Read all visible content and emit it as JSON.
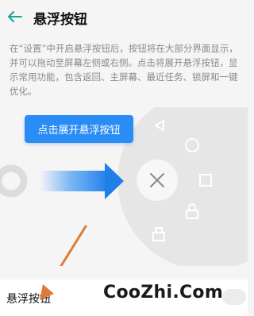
{
  "header": {
    "title": "悬浮按钮"
  },
  "description": "在“设置”中开启悬浮按钮后，按钮将在大部分界面显示，并可以拖动至屏幕左侧或右侧。点击将展开悬浮按钮，显示常用功能，包含返回、主屏幕、最近任务、锁屏和一键优化。",
  "illustration": {
    "expand_label": "点击展开悬浮按钮"
  },
  "setting": {
    "label": "悬浮按钮"
  },
  "watermark": "CooZhi.Com",
  "colors": {
    "accent": "#2a8cf5",
    "arrow_orange": "#e07a3a"
  }
}
